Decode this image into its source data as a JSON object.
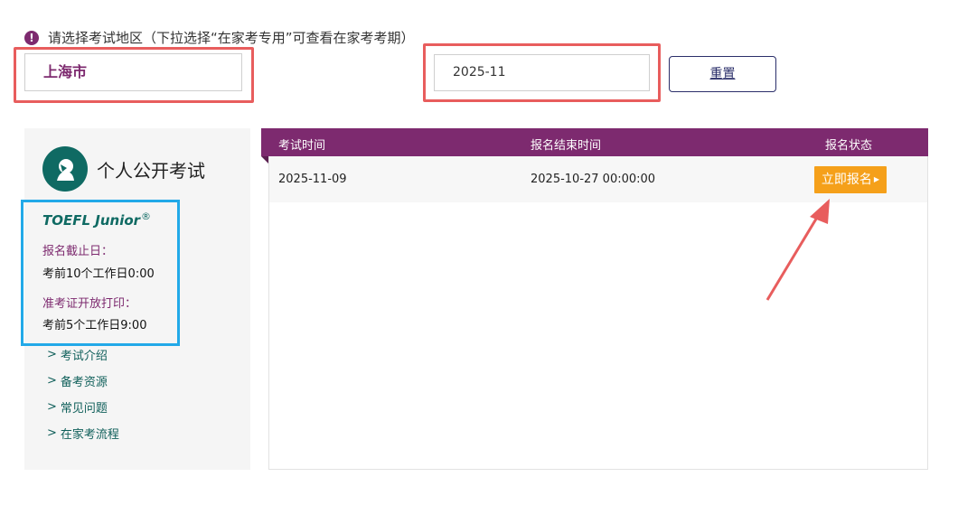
{
  "notice": {
    "icon": "exclamation-circle-icon",
    "text": "请选择考试地区（下拉选择“在家考专用”可查看在家考考期）"
  },
  "filters": {
    "region": "上海市",
    "period": "2025-11",
    "reset_label": "重置"
  },
  "sidebar": {
    "title": "个人公开考试",
    "logo_icon": "person-profile-logo-icon",
    "program": "TOEFL Junior",
    "program_mark": "®",
    "deadline_label": "报名截止日：",
    "deadline_value": "考前10个工作日0:00",
    "admission_label": "准考证开放打印：",
    "admission_value": "考前5个工作日9:00",
    "links": [
      "考试介绍",
      "备考资源",
      "常见问题",
      "在家考流程"
    ]
  },
  "table": {
    "headers": [
      "考试时间",
      "报名结束时间",
      "报名状态"
    ],
    "rows": [
      {
        "exam_date": "2025-11-09",
        "end_time": "2025-10-27 00:00:00",
        "status_button": "立即报名"
      }
    ]
  },
  "colors": {
    "brand_purple": "#7d2a6f",
    "brand_teal": "#0f6a63",
    "action_orange": "#f5a01a",
    "highlight_red": "#e85d5d",
    "highlight_blue": "#22a9e8"
  }
}
